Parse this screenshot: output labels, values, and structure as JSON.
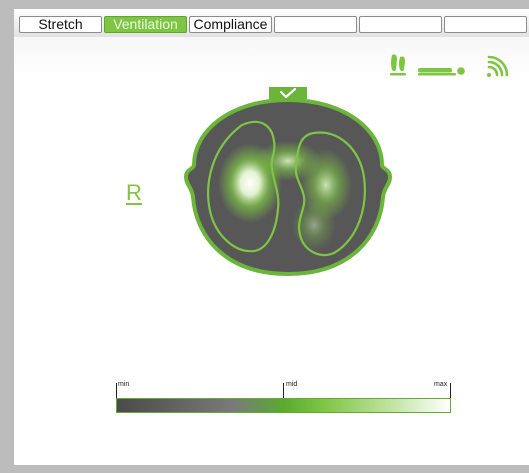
{
  "tabs": [
    {
      "label": "Stretch",
      "active": false
    },
    {
      "label": "Ventilation",
      "active": true
    },
    {
      "label": "Compliance",
      "active": false
    },
    {
      "label": "",
      "active": false
    },
    {
      "label": "",
      "active": false
    },
    {
      "label": "",
      "active": false
    }
  ],
  "sensor_icons": [
    "footprints-icon",
    "patient-supine-icon",
    "wireless-signal-icon"
  ],
  "orientation_label": "R",
  "image_status_icon": "checkmark-icon",
  "scale": {
    "min_label": "min",
    "mid_label": "mid",
    "max_label": "max"
  },
  "colors": {
    "accent_green": "#7ec544",
    "thorax_fill": "#595959",
    "background": "#bcbcbc"
  }
}
